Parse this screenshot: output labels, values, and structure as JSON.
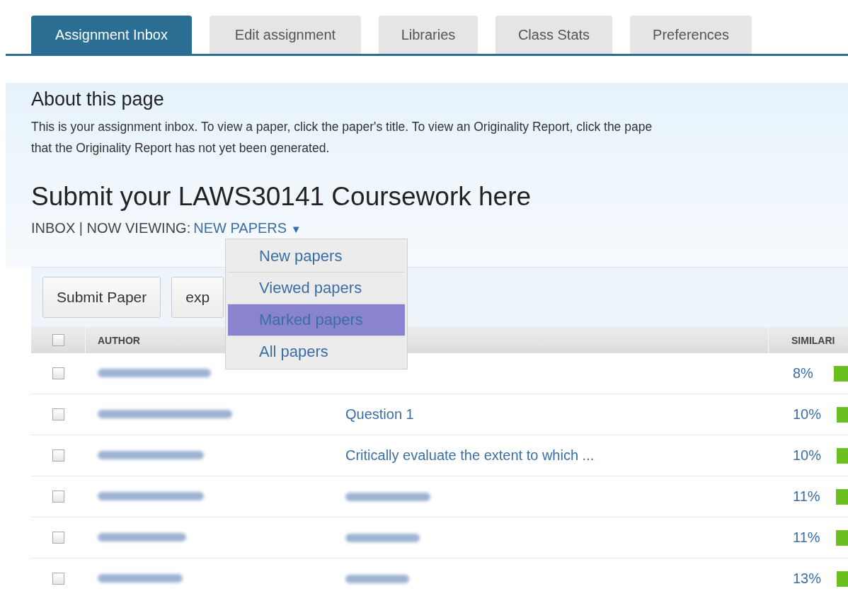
{
  "tabs": [
    {
      "label": "Assignment Inbox",
      "selected": true
    },
    {
      "label": "Edit assignment",
      "selected": false
    },
    {
      "label": "Libraries",
      "selected": false
    },
    {
      "label": "Class Stats",
      "selected": false
    },
    {
      "label": "Preferences",
      "selected": false
    }
  ],
  "about": {
    "heading": "About this page",
    "text_lines": [
      "This is your assignment inbox. To view a paper, click the paper's title. To view an Originality Report, click the pape",
      "that the Originality Report has not yet been generated."
    ]
  },
  "assignment_title": "Submit your LAWS30141 Coursework here",
  "breadcrumb": {
    "prefix": "INBOX | NOW VIEWING:",
    "filter": "NEW PAPERS",
    "caret": "▼"
  },
  "dropdown": [
    {
      "label": "New papers",
      "selected": false
    },
    {
      "label": "Viewed papers",
      "selected": false
    },
    {
      "label": "Marked papers",
      "selected": true
    },
    {
      "label": "All papers",
      "selected": false
    }
  ],
  "toolbar": {
    "buttons": [
      "Submit Paper",
      "exp"
    ]
  },
  "table": {
    "columns": [
      "AUTHOR",
      "SIMILARI"
    ],
    "select_all_checked": false,
    "rows": [
      {
        "checked": false,
        "similarity": "8%"
      },
      {
        "checked": false,
        "title": {
          "kind": "text",
          "text": "Question 1"
        },
        "similarity": "10%"
      },
      {
        "checked": false,
        "title": {
          "kind": "text",
          "text": "Critically evaluate the extent to which ..."
        },
        "similarity": "10%"
      },
      {
        "checked": false,
        "title": {
          "kind": "redacted"
        },
        "similarity": "11%"
      },
      {
        "checked": false,
        "title": {
          "kind": "redacted"
        },
        "similarity": "11%"
      },
      {
        "checked": false,
        "title": {
          "kind": "redacted"
        },
        "similarity": "13%"
      }
    ]
  }
}
